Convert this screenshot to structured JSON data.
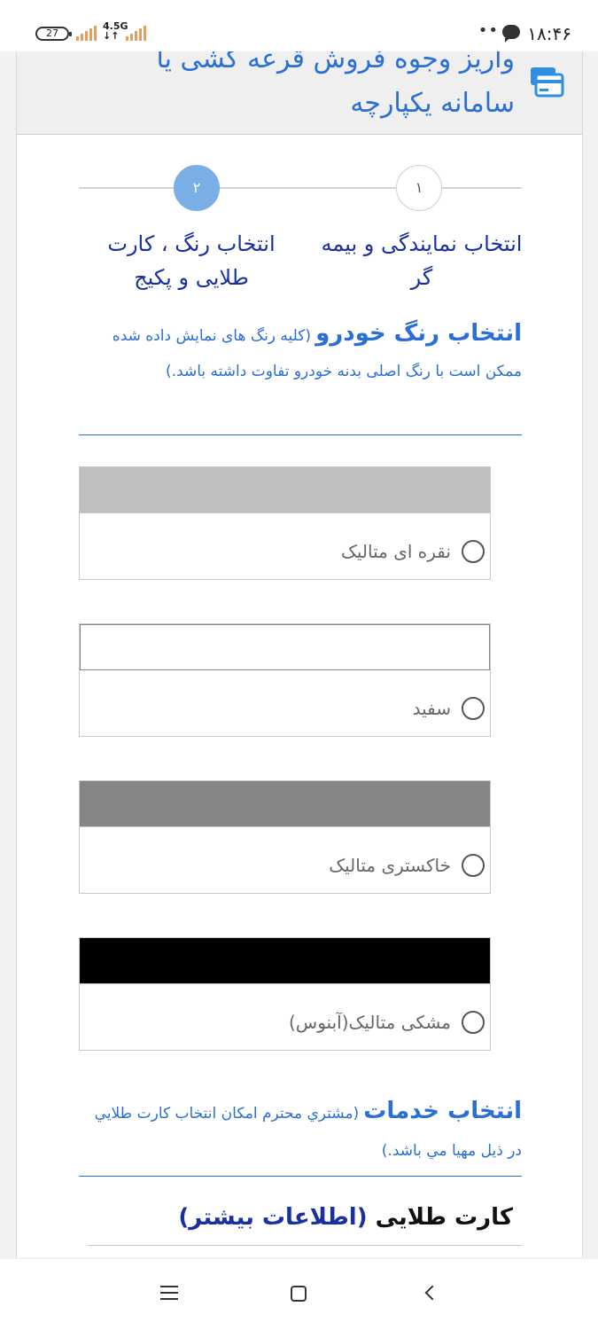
{
  "status_bar": {
    "time": "۱۸:۴۶",
    "battery": "27",
    "network": "4.5G",
    "network_sub": "↓↑",
    "dots": "••"
  },
  "header": {
    "title": "واریز وجوه فروش قرعه کشی یا سامانه یکپارچه",
    "icon": "credit-card-icon"
  },
  "stepper": {
    "steps": [
      {
        "number": "۱",
        "label": "انتخاب نمایندگی و بیمه گر",
        "active": false
      },
      {
        "number": "۲",
        "label": "انتخاب رنگ ، کارت طلایی و پکیج",
        "active": true
      }
    ]
  },
  "color_section": {
    "heading": "انتخاب رنگ خودرو",
    "note": "(کلیه رنگ های نمایش داده شده ممکن است با رنگ اصلی بدنه خودرو تفاوت داشته باشد.)"
  },
  "colors": [
    {
      "label": "نقره ای متالیک",
      "swatch": "#bfbfbf"
    },
    {
      "label": "سفید",
      "swatch": "#ffffff"
    },
    {
      "label": "خاکستری متالیک",
      "swatch": "#858585"
    },
    {
      "label": "مشکی متالیک(آبنوس)",
      "swatch": "#000000"
    }
  ],
  "services_section": {
    "heading": "انتخاب خدمات",
    "note": "(مشتري محترم امکان انتخاب کارت طلايي در ذيل مهيا مي باشد.)"
  },
  "gold_card": {
    "title": "کارت طلایی",
    "link": "(اطلاعات بیشتر)"
  },
  "theme": {
    "accent": "#2b6fd6",
    "heading_dark_blue": "#1a2fa0",
    "step_active": "#7aaee6"
  }
}
